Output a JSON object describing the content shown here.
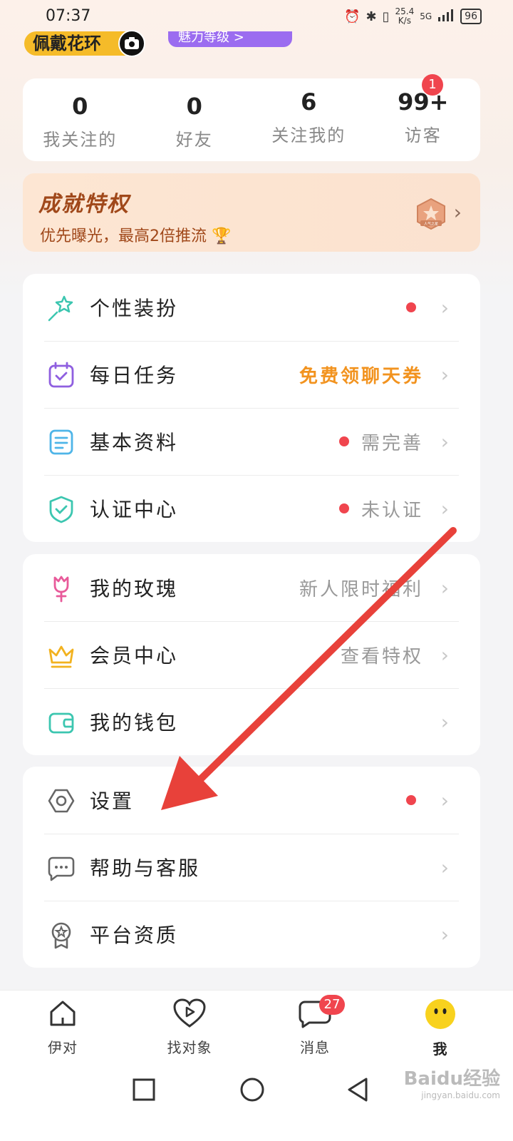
{
  "status_bar": {
    "time": "07:37",
    "net_speed_value": "25.4",
    "net_speed_unit": "K/s",
    "signal": "5G",
    "battery": "96"
  },
  "profile": {
    "flower_badge": "佩戴花环",
    "charm_label": "魅力等级 >"
  },
  "stats": [
    {
      "value": "0",
      "label": "我关注的"
    },
    {
      "value": "0",
      "label": "好友"
    },
    {
      "value": "6",
      "label": "关注我的"
    },
    {
      "value": "99+",
      "label": "访客"
    }
  ],
  "visitor_badge": "1",
  "achievement": {
    "title": "成就特权",
    "subtitle": "优先曝光，最高2倍推流",
    "medal_text": "人气之星"
  },
  "menu": {
    "group1": [
      {
        "label": "个性装扮",
        "right": "",
        "icon": "wand-icon"
      },
      {
        "label": "每日任务",
        "right": "免费领聊天券",
        "icon": "calendar-check-icon"
      },
      {
        "label": "基本资料",
        "right": "需完善",
        "icon": "document-icon"
      },
      {
        "label": "认证中心",
        "right": "未认证",
        "icon": "shield-check-icon"
      }
    ],
    "group2": [
      {
        "label": "我的玫瑰",
        "right": "新人限时福利",
        "icon": "rose-icon"
      },
      {
        "label": "会员中心",
        "right": "查看特权",
        "icon": "crown-icon"
      },
      {
        "label": "我的钱包",
        "right": "",
        "icon": "wallet-icon"
      }
    ],
    "group3": [
      {
        "label": "设置",
        "right": "",
        "icon": "settings-hex-icon"
      },
      {
        "label": "帮助与客服",
        "right": "",
        "icon": "chat-bubble-icon"
      },
      {
        "label": "平台资质",
        "right": "",
        "icon": "certificate-icon"
      }
    ]
  },
  "tabs": [
    {
      "label": "伊对",
      "icon": "home-icon"
    },
    {
      "label": "找对象",
      "icon": "heart-play-icon"
    },
    {
      "label": "消息",
      "icon": "message-icon",
      "badge": "27"
    },
    {
      "label": "我",
      "icon": "face-icon",
      "active": true
    }
  ],
  "watermark": {
    "main": "Baidu经验",
    "sub": "jingyan.baidu.com"
  },
  "colors": {
    "accent_orange": "#f2931f",
    "badge_red": "#f0454e",
    "annotation_red": "#e8413a",
    "achievement_text": "#a0481a"
  }
}
